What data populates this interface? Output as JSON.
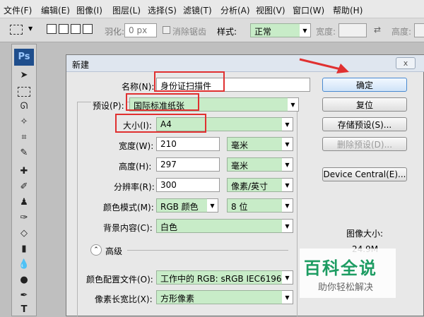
{
  "menu": [
    "文件(F)",
    "编辑(E)",
    "图像(I)",
    "图层(L)",
    "选择(S)",
    "滤镜(T)",
    "分析(A)",
    "视图(V)",
    "窗口(W)",
    "帮助(H)"
  ],
  "options": {
    "feather_label": "羽化:",
    "feather_value": "0 px",
    "antialias_label": "消除锯齿",
    "style_label": "样式:",
    "style_value": "正常",
    "width_label": "宽度:",
    "height_label": "高度:"
  },
  "toolbox": {
    "logo": "Ps"
  },
  "dialog": {
    "title": "新建",
    "close": "x",
    "name_label": "名称(N):",
    "name_value": "身份证扫描件",
    "preset_label": "预设(P):",
    "preset_value": "国际标准纸张",
    "size_label": "大小(I):",
    "size_value": "A4",
    "width_label": "宽度(W):",
    "width_value": "210",
    "width_unit": "毫米",
    "height_label": "高度(H):",
    "height_value": "297",
    "height_unit": "毫米",
    "resolution_label": "分辨率(R):",
    "resolution_value": "300",
    "resolution_unit": "像素/英寸",
    "colormode_label": "颜色模式(M):",
    "colormode_value": "RGB 颜色",
    "colordepth_value": "8 位",
    "background_label": "背景内容(C):",
    "background_value": "白色",
    "advanced_label": "高级",
    "profile_label": "颜色配置文件(O):",
    "profile_value": "工作中的 RGB: sRGB IEC6196...",
    "aspect_label": "像素长宽比(X):",
    "aspect_value": "方形像素",
    "ok": "确定",
    "reset": "复位",
    "save_preset": "存储预设(S)...",
    "delete_preset": "删除预设(D)...",
    "device_central": "Device Central(E)...",
    "image_size_label": "图像大小:",
    "image_size_value": "24.9M"
  },
  "watermark": {
    "title": "百科全说",
    "subtitle": "助你轻松解决"
  },
  "colors": {
    "accent_red": "#e03030",
    "field_green": "#c8ecc8"
  }
}
